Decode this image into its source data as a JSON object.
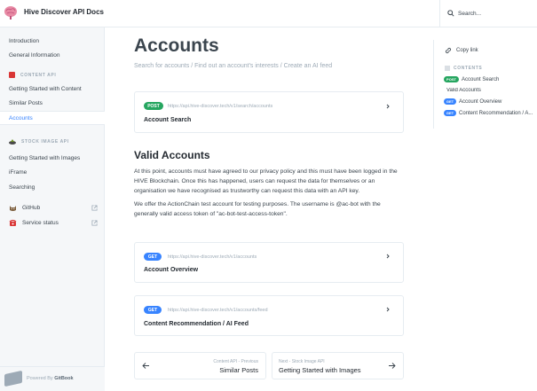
{
  "header": {
    "app_title": "Hive Discover API Docs",
    "search_placeholder": "Search..."
  },
  "sidebar": {
    "items_top": [
      {
        "label": "Introduction"
      },
      {
        "label": "General Information"
      }
    ],
    "content_api": {
      "heading": "CONTENT API",
      "items": [
        {
          "label": "Getting Started with Content"
        },
        {
          "label": "Similar Posts"
        },
        {
          "label": "Accounts",
          "active": true
        }
      ]
    },
    "stock_api": {
      "heading": "STOCK IMAGE API",
      "items": [
        {
          "label": "Getting Started with Images"
        },
        {
          "label": "iFrame"
        },
        {
          "label": "Searching"
        }
      ]
    },
    "links": [
      {
        "label": "GitHub",
        "icon": "cat-icon"
      },
      {
        "label": "Service status",
        "icon": "phone-icon"
      }
    ],
    "powered_by": "Powered By",
    "powered_brand": "GitBook"
  },
  "main": {
    "title": "Accounts",
    "description": "Search for accounts / Find out an account's interests / Create an AI feed",
    "cards": [
      {
        "method": "POST",
        "url": "https://api.hive-discover.tech/v1/search/accounts",
        "name": "Account Search"
      },
      {
        "method": "GET",
        "url": "https://api.hive-discover.tech/v1/accounts",
        "name": "Account Overview"
      },
      {
        "method": "GET",
        "url": "https://api.hive-discover.tech/v1/accounts/feed",
        "name": "Content Recommendation / AI Feed"
      }
    ],
    "section_title": "Valid Accounts",
    "para1": "At this point, accounts must have agreed to our privacy policy and this must have been logged in the HIVE Blockchain. Once this has happened, users can request the data for themselves or an organisation we have recognised as trustworthy can request this data with an API key.",
    "para2": "We offer the ActionChain test account for testing purposes. The username is @ac-bot with the generally valid access token of \"ac-bot-test-access-token\".",
    "prev": {
      "sub": "Content API - Previous",
      "title": "Similar Posts"
    },
    "next": {
      "sub": "Next - Stock Image API",
      "title": "Getting Started with Images"
    }
  },
  "toc": {
    "copy_link": "Copy link",
    "heading": "CONTENTS",
    "items": [
      {
        "badge": "POST",
        "label": "Account Search"
      },
      {
        "badge": "",
        "label": "Valid Accounts"
      },
      {
        "badge": "GET",
        "label": "Account Overview"
      },
      {
        "badge": "GET",
        "label": "Content Recommendation / A..."
      }
    ]
  },
  "colors": {
    "accent": "#3884ff",
    "post": "#26a660",
    "get": "#3884ff",
    "sidebar_bg": "#f5f7f9"
  }
}
